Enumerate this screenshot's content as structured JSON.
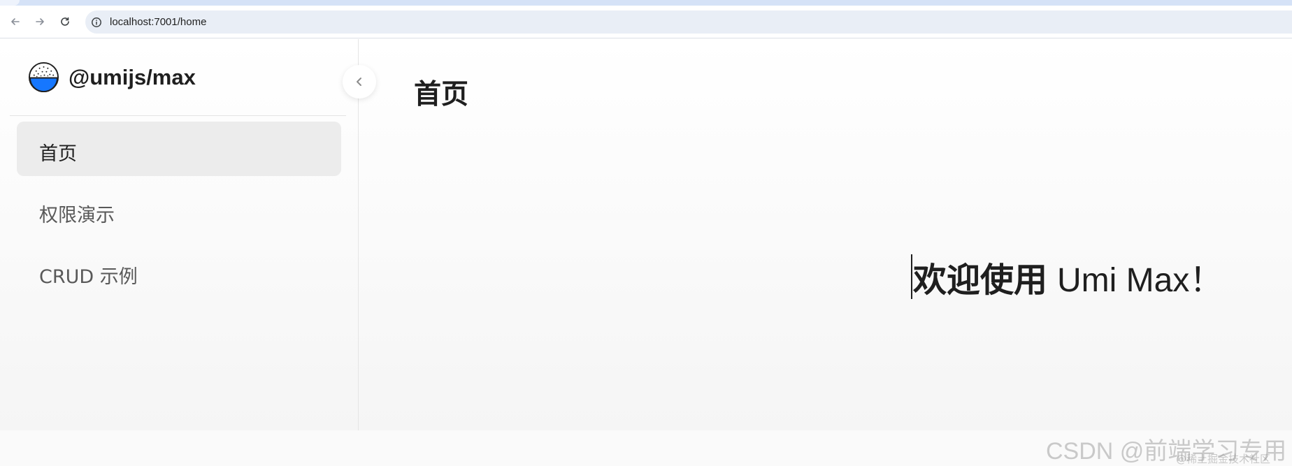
{
  "browser": {
    "url": "localhost:7001/home",
    "back_icon": "arrow-left-icon",
    "forward_icon": "arrow-right-icon",
    "reload_icon": "reload-icon",
    "site_info_icon": "info-circle-icon"
  },
  "sidebar": {
    "logo_icon": "rice-bowl-icon",
    "title": "@umijs/max",
    "items": [
      {
        "label": "首页",
        "active": true
      },
      {
        "label": "权限演示",
        "active": false
      },
      {
        "label": "CRUD 示例",
        "active": false
      }
    ],
    "collapse_icon": "chevron-left-icon"
  },
  "main": {
    "page_title": "首页",
    "welcome_strong": "欢迎使用",
    "welcome_rest": "Umi Max！"
  },
  "watermark": {
    "text": "CSDN @前端学习专用",
    "subtext": "@稀土掘金技术社区"
  },
  "colors": {
    "accent": "#1677ff",
    "active_menu_bg": "#ececec",
    "omnibox_bg": "#e9eef6"
  }
}
